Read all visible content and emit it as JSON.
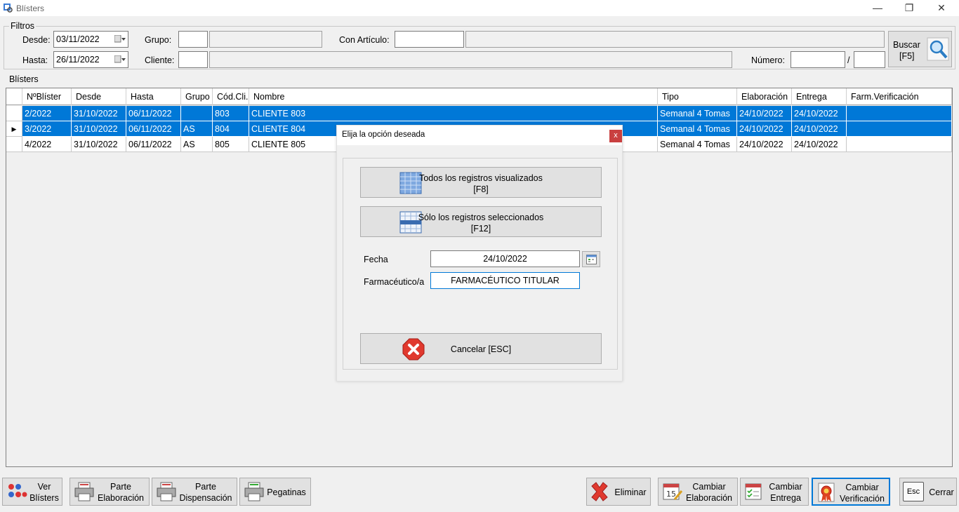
{
  "window": {
    "title": "Blísters",
    "minimize": "—",
    "maximize": "❐",
    "close": "✕"
  },
  "filters": {
    "group_label": "Filtros",
    "desde_label": "Desde:",
    "desde_value": "03/11/2022",
    "hasta_label": "Hasta:",
    "hasta_value": "26/11/2022",
    "grupo_label": "Grupo:",
    "cliente_label": "Cliente:",
    "articulo_label": "Con Artículo:",
    "numero_label": "Número:",
    "numero_sep": "/",
    "buscar_label": "Buscar",
    "buscar_key": "[F5]"
  },
  "blisters": {
    "group_label": "Blísters",
    "columns": [
      "NºBlíster",
      "Desde",
      "Hasta",
      "Grupo",
      "Cód.Cli.",
      "Nombre",
      "Tipo",
      "Elaboración",
      "Entrega",
      "Farm.Verificación"
    ],
    "rows": [
      {
        "num": "2/2022",
        "desde": "31/10/2022",
        "hasta": "06/11/2022",
        "grupo": "",
        "cod": "803",
        "nombre": "CLIENTE 803",
        "tipo": "Semanal 4 Tomas",
        "elab": "24/10/2022",
        "entrega": "24/10/2022",
        "farm": ""
      },
      {
        "num": "3/2022",
        "desde": "31/10/2022",
        "hasta": "06/11/2022",
        "grupo": "AS",
        "cod": "804",
        "nombre": "CLIENTE 804",
        "tipo": "Semanal 4 Tomas",
        "elab": "24/10/2022",
        "entrega": "24/10/2022",
        "farm": ""
      },
      {
        "num": "4/2022",
        "desde": "31/10/2022",
        "hasta": "06/11/2022",
        "grupo": "AS",
        "cod": "805",
        "nombre": "CLIENTE 805",
        "tipo": "Semanal 4 Tomas",
        "elab": "24/10/2022",
        "entrega": "24/10/2022",
        "farm": ""
      }
    ],
    "current_marker": "▶"
  },
  "toolbar": {
    "ver_blisters": [
      "Ver",
      "Blísters"
    ],
    "parte_elaboracion": [
      "Parte",
      "Elaboración"
    ],
    "parte_dispensacion": [
      "Parte",
      "Dispensación"
    ],
    "pegatinas": "Pegatinas",
    "eliminar": "Eliminar",
    "cambiar_elaboracion": [
      "Cambiar",
      "Elaboración"
    ],
    "cambiar_entrega": [
      "Cambiar",
      "Entrega"
    ],
    "cambiar_verificacion": [
      "Cambiar",
      "Verificación"
    ],
    "cerrar": "Cerrar",
    "esc_key": "Esc",
    "cal_num": "15"
  },
  "dialog": {
    "title": "Elija la opción deseada",
    "close": "x",
    "todos": [
      "Todos los registros visualizados",
      "[F8]"
    ],
    "solo": [
      "Sólo los registros seleccionados",
      "[F12]"
    ],
    "fecha_label": "Fecha",
    "fecha_value": "24/10/2022",
    "farm_label": "Farmacéutico/a",
    "farm_value": "FARMACÉUTICO TITULAR",
    "cancelar": "Cancelar [ESC]"
  },
  "colors": {
    "selection": "#0078d7",
    "button_face": "#e1e1e1",
    "dialog_close": "#c94040"
  }
}
